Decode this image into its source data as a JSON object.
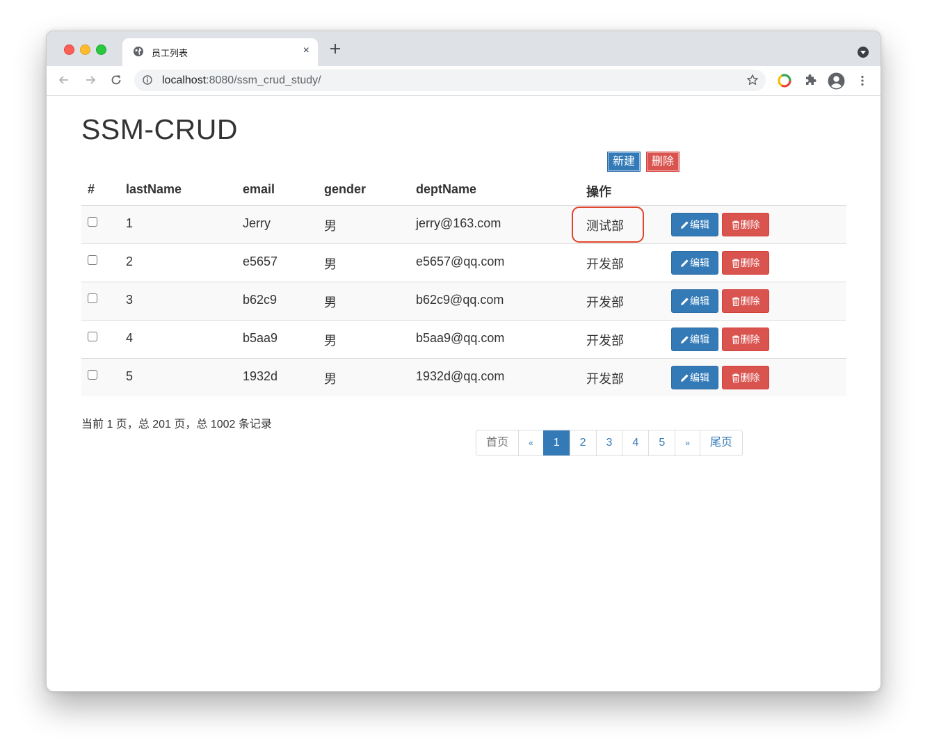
{
  "browser": {
    "tab_title": "员工列表",
    "tab_close": "×",
    "url_host": "localhost",
    "url_rest": ":8080/ssm_crud_study/"
  },
  "page": {
    "title": "SSM-CRUD",
    "new_button": "新建",
    "delete_button": "删除"
  },
  "table": {
    "headers": [
      "#",
      "lastName",
      "email",
      "gender",
      "deptName",
      "操作"
    ],
    "rows": [
      {
        "id": "1",
        "last_name": "Jerry",
        "gender": "男",
        "email": "jerry@163.com",
        "dept": "测试部"
      },
      {
        "id": "2",
        "last_name": "e5657",
        "gender": "男",
        "email": "e5657@qq.com",
        "dept": "开发部"
      },
      {
        "id": "3",
        "last_name": "b62c9",
        "gender": "男",
        "email": "b62c9@qq.com",
        "dept": "开发部"
      },
      {
        "id": "4",
        "last_name": "b5aa9",
        "gender": "男",
        "email": "b5aa9@qq.com",
        "dept": "开发部"
      },
      {
        "id": "5",
        "last_name": "1932d",
        "gender": "男",
        "email": "1932d@qq.com",
        "dept": "开发部"
      }
    ],
    "edit_label": "编辑",
    "delete_label": "删除"
  },
  "pagination": {
    "info": "当前 1 页，总 201 页，总 1002 条记录",
    "first": "首页",
    "prev": "«",
    "pages": [
      "1",
      "2",
      "3",
      "4",
      "5"
    ],
    "active_page": "1",
    "next": "»",
    "last": "尾页"
  },
  "colors": {
    "primary": "#337ab7",
    "danger": "#d9534f",
    "highlight": "#e0442a"
  }
}
